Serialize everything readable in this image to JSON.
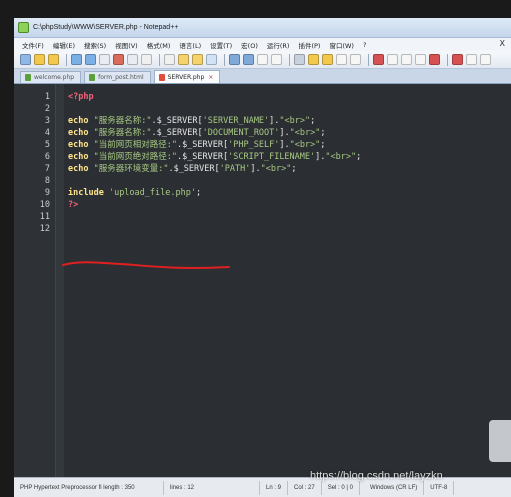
{
  "window": {
    "title": "C:\\phpStudy\\WWW\\SERVER.php - Notepad++"
  },
  "menubar": {
    "items": [
      "文件(F)",
      "编辑(E)",
      "搜索(S)",
      "视图(V)",
      "格式(M)",
      "语言(L)",
      "设置(T)",
      "宏(O)",
      "运行(R)",
      "插件(P)",
      "窗口(W)",
      "?"
    ],
    "close_glyph": "X"
  },
  "toolbar": {
    "button_colors": [
      "#8fb7e8",
      "#f2c94c",
      "#f2c94c",
      "#7bb0e6",
      "#7bb0e6",
      "#e9edf3",
      "#d96b5a",
      "#e9edf3",
      "#f0f0f0",
      "#f0f0f0",
      "#f5d26b",
      "#f5d26b",
      "#d2e3f5",
      "#7fa9d8",
      "#7fa9d8",
      "#f6f6f6",
      "#f6f6f6",
      "#c8d2de",
      "#f2c94c",
      "#f2c94c",
      "#f6f6f6",
      "#f6f6f6",
      "#d65252",
      "#f6f6f6",
      "#f6f6f6",
      "#f6f6f6",
      "#d65252",
      "#d65252",
      "#f6f6f6",
      "#f6f6f6"
    ]
  },
  "tabs": [
    {
      "label": "welcome.php",
      "active": false
    },
    {
      "label": "form_post.html",
      "active": false
    },
    {
      "label": "SERVER.php",
      "active": true
    }
  ],
  "editor": {
    "line_numbers": [
      "1",
      "2",
      "3",
      "4",
      "5",
      "6",
      "7",
      "8",
      "9",
      "10",
      "11",
      "12"
    ],
    "lines": [
      [
        {
          "t": "tag",
          "v": "<?php"
        }
      ],
      [],
      [
        {
          "t": "kw",
          "v": "echo "
        },
        {
          "t": "str",
          "v": "\"服务器名称:\""
        },
        {
          "t": "op",
          "v": ".$_SERVER["
        },
        {
          "t": "str",
          "v": "'SERVER_NAME'"
        },
        {
          "t": "op",
          "v": "]."
        },
        {
          "t": "str",
          "v": "\"<br>\""
        },
        {
          "t": "op",
          "v": ";"
        }
      ],
      [
        {
          "t": "kw",
          "v": "echo "
        },
        {
          "t": "str",
          "v": "\"服务器名称:\""
        },
        {
          "t": "op",
          "v": ".$_SERVER["
        },
        {
          "t": "str",
          "v": "'DOCUMENT_ROOT'"
        },
        {
          "t": "op",
          "v": "]."
        },
        {
          "t": "str",
          "v": "\"<br>\""
        },
        {
          "t": "op",
          "v": ";"
        }
      ],
      [
        {
          "t": "kw",
          "v": "echo "
        },
        {
          "t": "str",
          "v": "\"当前网页相对路径:\""
        },
        {
          "t": "op",
          "v": ".$_SERVER["
        },
        {
          "t": "str",
          "v": "'PHP_SELF'"
        },
        {
          "t": "op",
          "v": "]."
        },
        {
          "t": "str",
          "v": "\"<br>\""
        },
        {
          "t": "op",
          "v": ";"
        }
      ],
      [
        {
          "t": "kw",
          "v": "echo "
        },
        {
          "t": "str",
          "v": "\"当前网页绝对路径:\""
        },
        {
          "t": "op",
          "v": ".$_SERVER["
        },
        {
          "t": "str",
          "v": "'SCRIPT_FILENAME'"
        },
        {
          "t": "op",
          "v": "]."
        },
        {
          "t": "str",
          "v": "\"<br>\""
        },
        {
          "t": "op",
          "v": ";"
        }
      ],
      [
        {
          "t": "kw",
          "v": "echo "
        },
        {
          "t": "str",
          "v": "\"服务器环境变量:\""
        },
        {
          "t": "op",
          "v": ".$_SERVER["
        },
        {
          "t": "str",
          "v": "'PATH'"
        },
        {
          "t": "op",
          "v": "]."
        },
        {
          "t": "str",
          "v": "\"<br>\""
        },
        {
          "t": "op",
          "v": ";"
        }
      ],
      [],
      [
        {
          "t": "kw",
          "v": "include "
        },
        {
          "t": "str",
          "v": "'upload_file.php'"
        },
        {
          "t": "op",
          "v": ";"
        }
      ],
      [
        {
          "t": "tag",
          "v": "?>"
        }
      ],
      [],
      []
    ]
  },
  "statusbar": {
    "file_type": "PHP Hypertext Preprocessor fi length : 350",
    "lines": "lines : 12",
    "ln": "Ln : 9",
    "col": "Col : 27",
    "sel": "Sel : 0 | 0",
    "eol": "Windows (CR LF)",
    "encoding": "UTF-8"
  },
  "watermark": "https://blog.csdn.net/layzkn",
  "colors": {
    "editor_bg": "#2b2f33",
    "tag": "#f0627a",
    "keyword": "#ffe48a",
    "string": "#a8c983",
    "annotation_red": "#e02020"
  }
}
